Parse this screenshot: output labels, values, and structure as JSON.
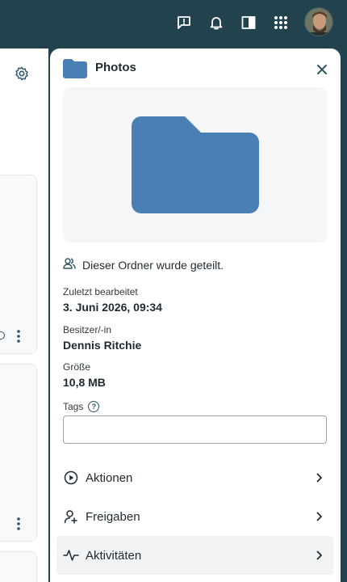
{
  "colors": {
    "topbar": "#22424e",
    "folder": "#4a7fb5",
    "icon_dark": "#2e5664",
    "panel_bg": "#ffffff",
    "preview_bg": "#f5f6f7"
  },
  "topbar": {
    "icons": [
      "feedback-icon",
      "notifications-icon",
      "sidebar-toggle-icon",
      "apps-grid-icon"
    ],
    "avatar": "user-avatar"
  },
  "drawer": {
    "title": "Photos",
    "shared_text": "Dieser Ordner wurde geteilt.",
    "meta": {
      "modified_label": "Zuletzt bearbeitet",
      "modified_value": "3. Juni 2026, 09:34",
      "owner_label": "Besitzer/-in",
      "owner_value": "Dennis Ritchie",
      "size_label": "Größe",
      "size_value": "10,8 MB"
    },
    "tags": {
      "label": "Tags",
      "value": "",
      "placeholder": ""
    },
    "nav": [
      {
        "label": "Aktionen",
        "icon": "play-circle-icon"
      },
      {
        "label": "Freigaben",
        "icon": "user-plus-icon"
      },
      {
        "label": "Aktivitäten",
        "icon": "activity-icon"
      }
    ]
  }
}
